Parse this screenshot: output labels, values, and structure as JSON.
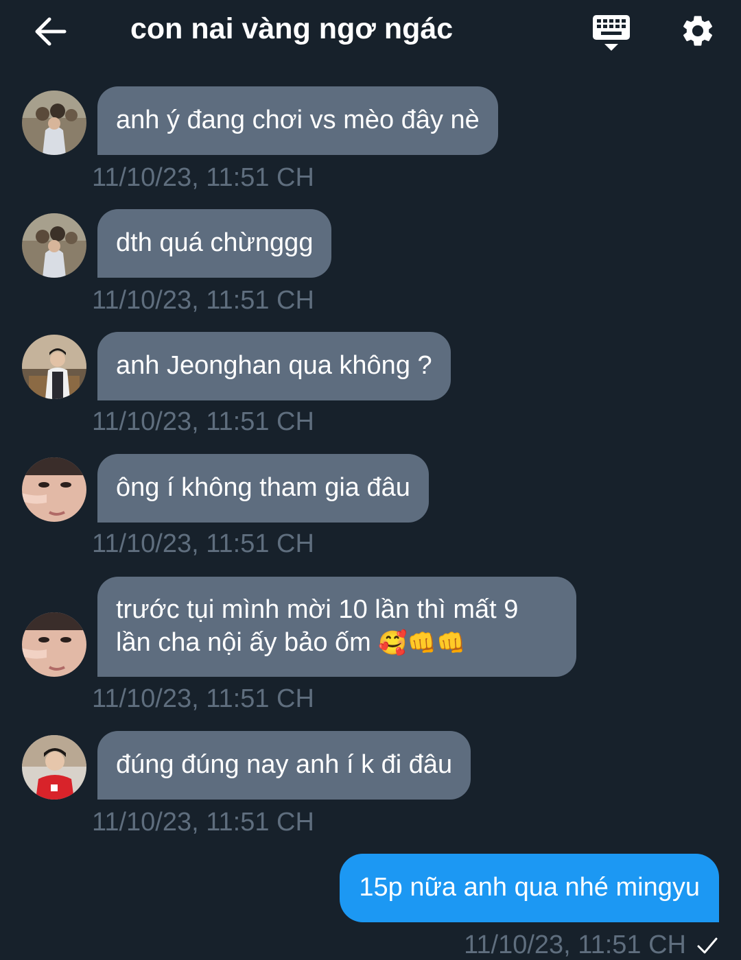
{
  "header": {
    "title": "con nai vàng ngơ ngác"
  },
  "colors": {
    "background": "#17212b",
    "incoming_bubble": "#5e6d7f",
    "outgoing_bubble": "#1c98f3",
    "timestamp": "#5f6e7e"
  },
  "messages": [
    {
      "text": "anh ý đang chơi vs mèo đây nè",
      "time": "11/10/23, 11:51 CH"
    },
    {
      "text": "dth quá chừnggg",
      "time": "11/10/23, 11:51 CH"
    },
    {
      "text": "anh Jeonghan qua không ?",
      "time": "11/10/23, 11:51 CH"
    },
    {
      "text": "ông í không tham gia đâu",
      "time": "11/10/23, 11:51 CH"
    },
    {
      "text_line1": "trước tụi mình mời 10 lần thì mất 9",
      "text_line2": "lần cha nội ấy bảo ốm",
      "emojis": "🥰👊👊",
      "time": "11/10/23, 11:51 CH"
    },
    {
      "text": "đúng đúng nay anh í k đi đâu",
      "time": "11/10/23, 11:51 CH"
    }
  ],
  "outgoing": {
    "text": "15p nữa anh qua nhé mingyu",
    "time": "11/10/23, 11:51 CH",
    "status_icon": "check-icon"
  }
}
